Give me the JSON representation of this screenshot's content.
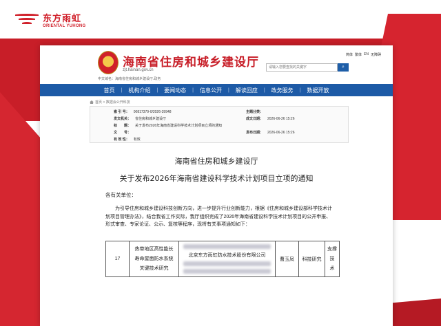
{
  "brand": {
    "name_cn": "东方雨虹",
    "name_en": "ORIENTAL YUHONG",
    "color": "#d0202a"
  },
  "site": {
    "title": "海南省住房和城乡建设厅",
    "domain": "zjt.hainan.gov.cn",
    "cn_domain": "中文域名：海南省住房和城乡建设厅.政务",
    "search_placeholder": "请输入您要查找的关键字",
    "search_icon": "search-icon",
    "util_links": [
      "简体",
      "繁体",
      "EN",
      "无障碍"
    ],
    "accent": "#1d5aa6",
    "title_color": "#c81e28"
  },
  "nav": {
    "items": [
      "首页",
      "机构介绍",
      "要闻动态",
      "信息公开",
      "解读回应",
      "政务服务",
      "数据开放"
    ]
  },
  "breadcrumb": {
    "text": "首页 > 数据会公开科技"
  },
  "meta": {
    "index_label": "索 引 号：",
    "index_value": "00817379-0/2026-39948",
    "category_label": "主题分类：",
    "publisher_label": "发文机关：",
    "publisher_value": "省住房和城乡建设厅",
    "issue_date_label": "成文日期：",
    "issue_date_value": "2026-06-26 15:26",
    "title_label": "标　　题：",
    "title_value": "关于发布2026年海南省建设科学技术计划项目立项的通知",
    "docno_label": "文　　号：",
    "pubdate_label": "发布日期：",
    "pubdate_value": "2026-06-26 15:26",
    "topic_label": "主 题 词：",
    "validity_label": "有 效 性：",
    "validity_value": "有效"
  },
  "document": {
    "org": "海南省住房和城乡建设厅",
    "title": "关于发布2026年海南省建设科学技术计划项目立项的通知",
    "greeting": "各有关单位：",
    "body": "为引导住房和城乡建设科技创新方向，进一步提升行业创新能力，根据《住房和城乡建设部科学技术计划项目管理办法》，结合我省工作实际，我厅组织完成了2026年海南省建设科学技术计划项目的公开申报、形式审查、专家论证、公示、复核等程序，现将有关事项通知如下："
  },
  "project_row": {
    "number": "17",
    "name_lines": [
      "热带地区高性能长",
      "寿命屋面防水系统",
      "关键技术研究"
    ],
    "unit_visible": "北京东方雨虹防水技术股份有限公司",
    "leader": "曹玉凤",
    "category": "科技研究",
    "support_lines": [
      "支撑技",
      "术"
    ]
  }
}
